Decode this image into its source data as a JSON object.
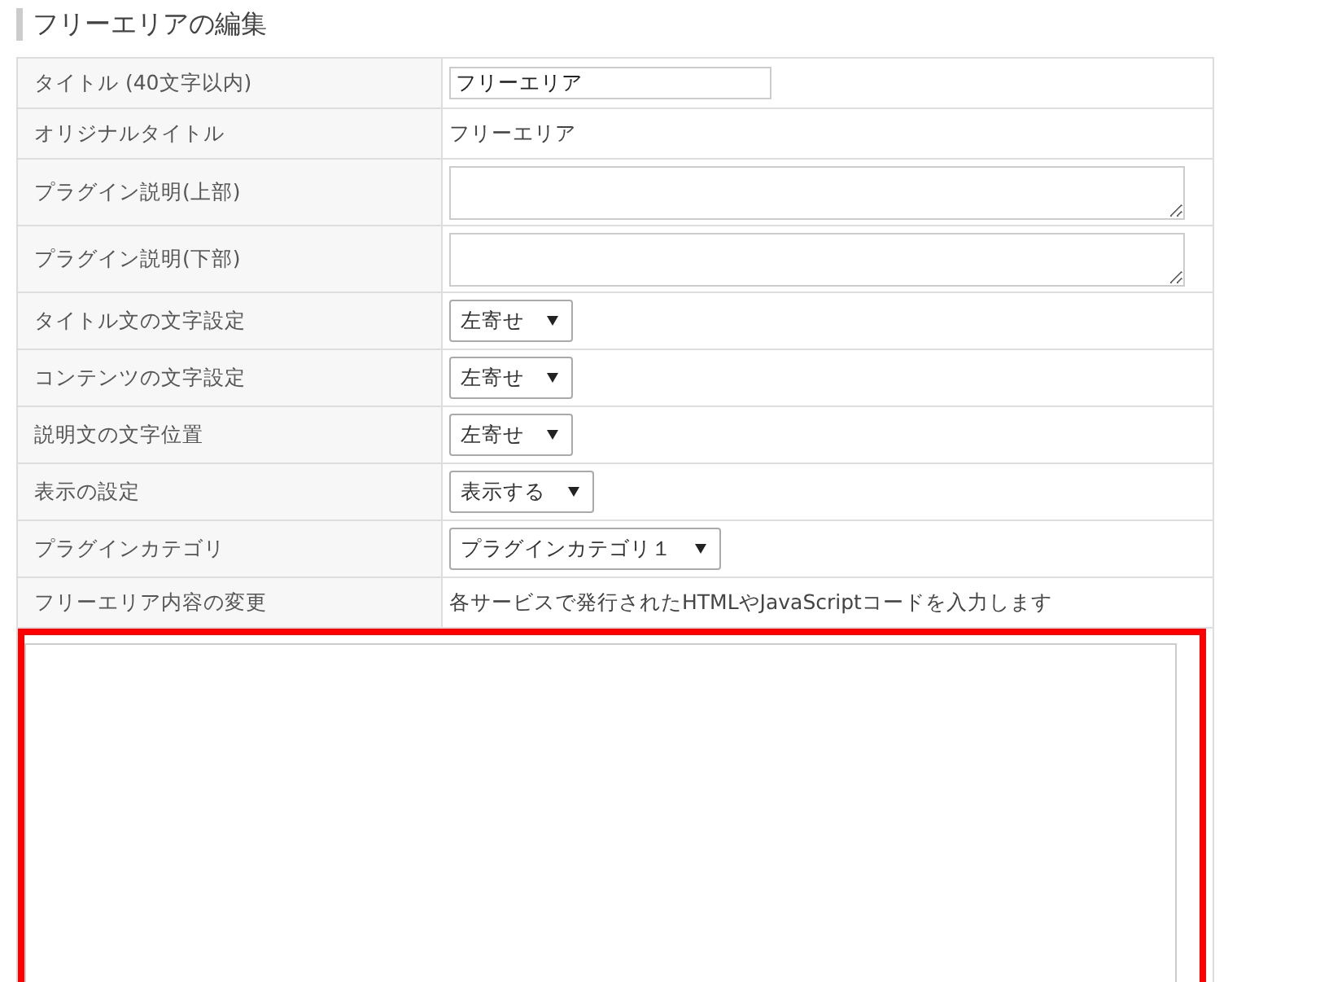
{
  "heading": "フリーエリアの編集",
  "rows": [
    {
      "kind": "input",
      "label": "タイトル (40文字以内)",
      "value": "フリーエリア"
    },
    {
      "kind": "text",
      "label": "オリジナルタイトル",
      "value": "フリーエリア"
    },
    {
      "kind": "textarea",
      "label": "プラグイン説明(上部)"
    },
    {
      "kind": "textarea",
      "label": "プラグイン説明(下部)"
    },
    {
      "kind": "select",
      "label": "タイトル文の文字設定",
      "value": "左寄せ"
    },
    {
      "kind": "select",
      "label": "コンテンツの文字設定",
      "value": "左寄せ"
    },
    {
      "kind": "select",
      "label": "説明文の文字位置",
      "value": "左寄せ"
    },
    {
      "kind": "select",
      "label": "表示の設定",
      "value": "表示する"
    },
    {
      "kind": "select",
      "label": "プラグインカテゴリ",
      "value": "プラグインカテゴリ１"
    },
    {
      "kind": "text",
      "label": "フリーエリア内容の変更",
      "value": "各サービスで発行されたHTMLやJavaScriptコードを入力します"
    }
  ],
  "code_editor": {
    "highlighted": true
  }
}
